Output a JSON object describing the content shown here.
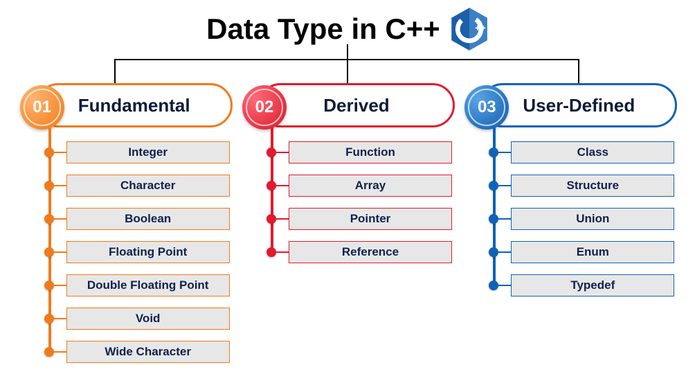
{
  "title": "Data Type in C++",
  "logo_name": "cpp-logo",
  "categories": [
    {
      "number": "01",
      "label": "Fundamental",
      "color": "#f07b1a",
      "items": [
        "Integer",
        "Character",
        "Boolean",
        "Floating Point",
        "Double Floating Point",
        "Void",
        "Wide Character"
      ]
    },
    {
      "number": "02",
      "label": "Derived",
      "color": "#e11a2d",
      "items": [
        "Function",
        "Array",
        "Pointer",
        "Reference"
      ]
    },
    {
      "number": "03",
      "label": "User-Defined",
      "color": "#0f62b7",
      "items": [
        "Class",
        "Structure",
        "Union",
        "Enum",
        "Typedef"
      ]
    }
  ]
}
